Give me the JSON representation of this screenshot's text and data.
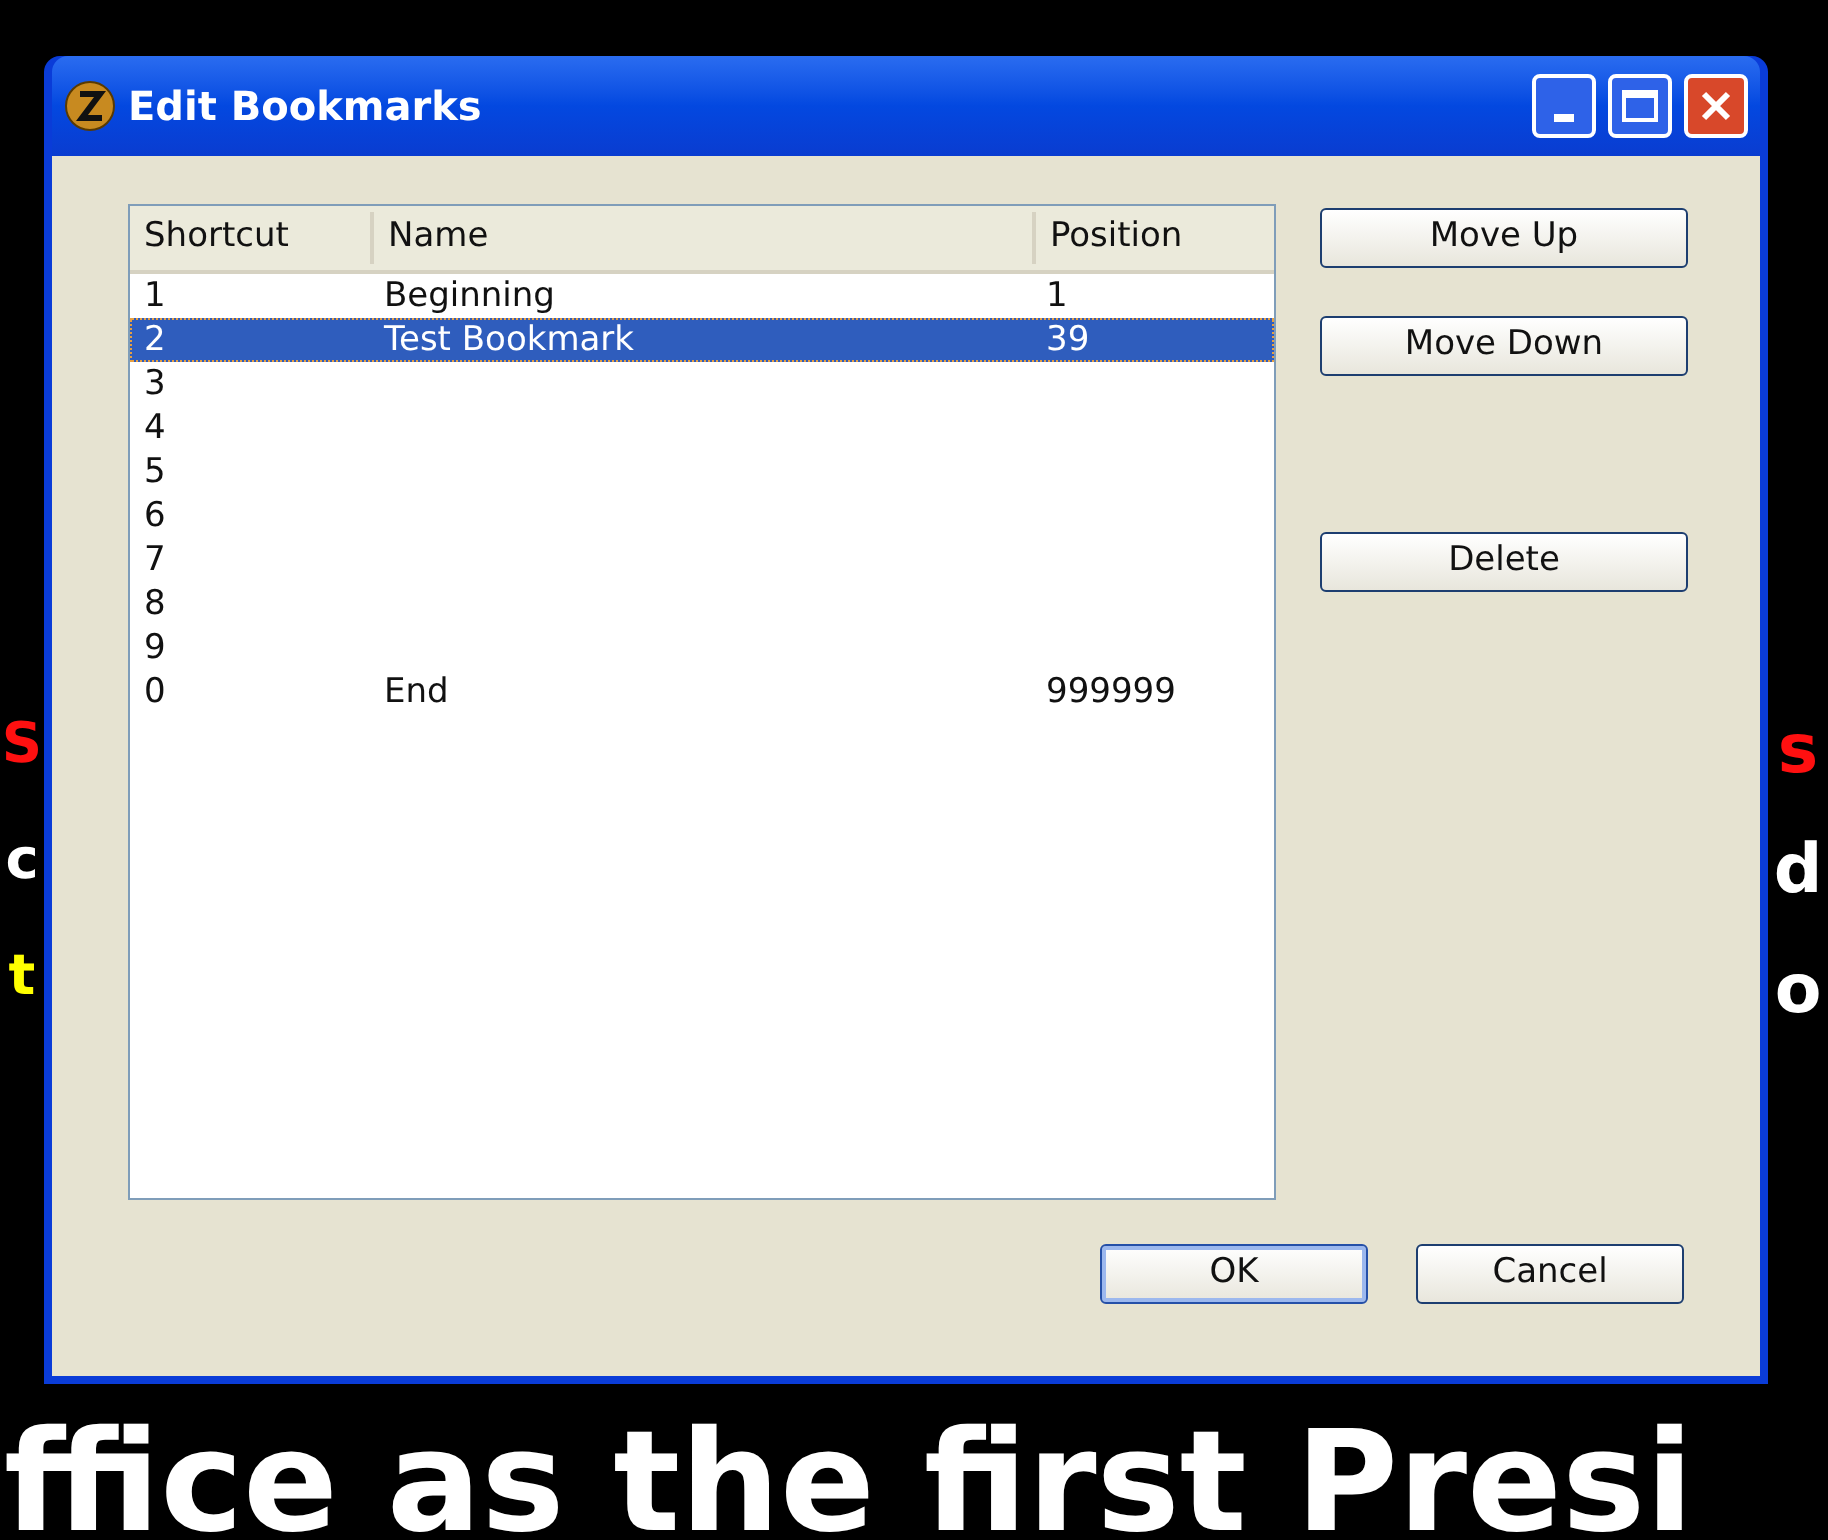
{
  "background_text": {
    "left": [
      {
        "text": "S",
        "color": "#ff1010"
      },
      {
        "text": "c",
        "color": "#ffffff"
      },
      {
        "text": "t",
        "color": "#ffff00"
      }
    ],
    "right": [
      {
        "text": "s",
        "color": "#ff1010"
      },
      {
        "text": "d",
        "color": "#ffffff"
      },
      {
        "text": "o",
        "color": "#ffffff"
      }
    ],
    "bottom": "ffice as the first Presi"
  },
  "window": {
    "title": "Edit Bookmarks"
  },
  "table": {
    "columns": [
      "Shortcut",
      "Name",
      "Position"
    ],
    "rows": [
      {
        "cells": [
          "1",
          "Beginning",
          "1"
        ],
        "selected": false
      },
      {
        "cells": [
          "2",
          "Test Bookmark",
          "39"
        ],
        "selected": true
      },
      {
        "cells": [
          "3",
          "",
          ""
        ],
        "selected": false
      },
      {
        "cells": [
          "4",
          "",
          ""
        ],
        "selected": false
      },
      {
        "cells": [
          "5",
          "",
          ""
        ],
        "selected": false
      },
      {
        "cells": [
          "6",
          "",
          ""
        ],
        "selected": false
      },
      {
        "cells": [
          "7",
          "",
          ""
        ],
        "selected": false
      },
      {
        "cells": [
          "8",
          "",
          ""
        ],
        "selected": false
      },
      {
        "cells": [
          "9",
          "",
          ""
        ],
        "selected": false
      },
      {
        "cells": [
          "0",
          "End",
          "999999"
        ],
        "selected": false
      }
    ]
  },
  "side_buttons": [
    {
      "label": "Move Up",
      "kind": "button"
    },
    {
      "label": "Move Down",
      "kind": "button"
    },
    {
      "kind": "gap"
    },
    {
      "label": "Delete",
      "kind": "button"
    }
  ],
  "footer_buttons": [
    {
      "label": "OK",
      "default": true
    },
    {
      "label": "Cancel",
      "default": false
    }
  ]
}
